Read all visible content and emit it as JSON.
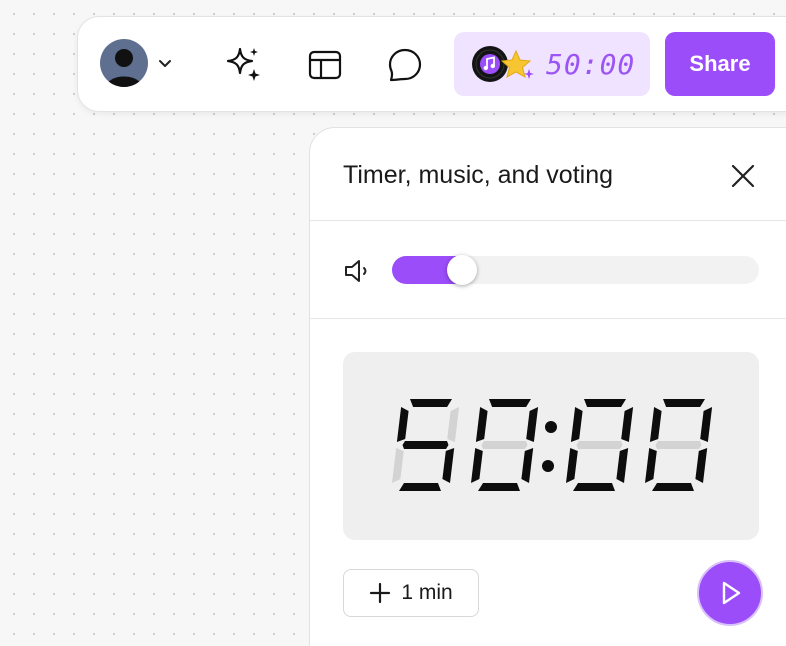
{
  "toolbar": {
    "avatar_icon": "user-avatar-icon",
    "dropdown_icon": "chevron-down-icon",
    "icons": [
      "sparkles-icon",
      "layout-icon",
      "comment-icon"
    ],
    "timer_chip": {
      "icons": [
        "music-disc-icon",
        "star-icon"
      ],
      "time": "50:00"
    },
    "share_label": "Share"
  },
  "panel": {
    "title": "Timer, music, and voting",
    "close_icon": "close-icon",
    "volume": {
      "icon": "volume-icon",
      "level": 0.19
    },
    "timer": {
      "minutes": "50",
      "seconds": "00",
      "display": "50:00"
    },
    "add_button_label": "1 min",
    "add_icon": "plus-icon",
    "play_icon": "play-icon"
  },
  "colors": {
    "accent": "#9b4dfa",
    "chip_background": "#efe3ff",
    "chip_text": "#9b55f5",
    "clock_background": "#efefef"
  }
}
